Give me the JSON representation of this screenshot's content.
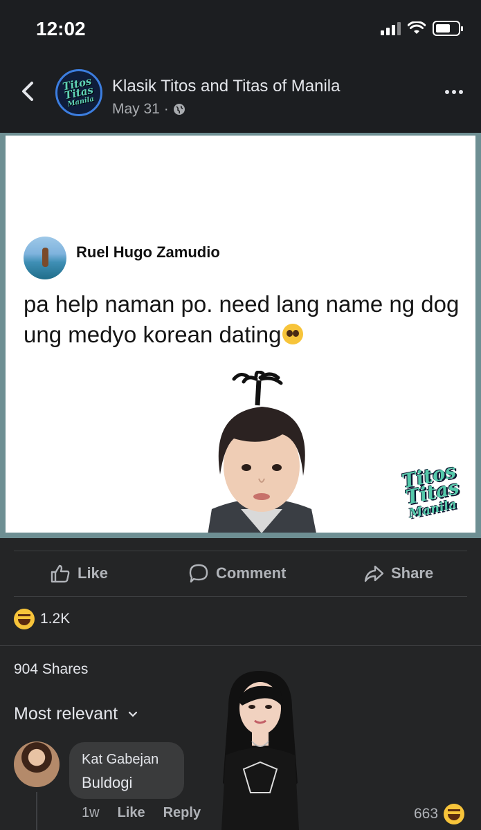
{
  "status_bar": {
    "time": "12:02"
  },
  "header": {
    "group_name": "Klasik Titos and Titas of Manila",
    "date": "May 31 ·",
    "group_logo_text": [
      "Titos",
      "Titas",
      "Manila"
    ]
  },
  "post": {
    "author": "Ruel Hugo Zamudio",
    "text": "pa help naman po. need lang name ng dog ung medyo korean dating",
    "watermark": [
      "Titos",
      "Titas",
      "Manila"
    ]
  },
  "actions": {
    "like": "Like",
    "comment": "Comment",
    "share": "Share"
  },
  "stats": {
    "reactions": "1.2K",
    "shares": "904 Shares"
  },
  "sort": {
    "label": "Most relevant"
  },
  "comment": {
    "author": "Kat Gabejan",
    "text": "Buldogi",
    "age": "1w",
    "like": "Like",
    "reply": "Reply",
    "reaction_count": "663"
  },
  "icons": [
    "signal-icon",
    "wifi-icon",
    "battery-icon",
    "back-icon",
    "globe-icon",
    "more-icon",
    "like-icon",
    "comment-icon",
    "share-icon",
    "haha-icon",
    "chevron-down-icon",
    "pleading-face-icon"
  ],
  "colors": {
    "background": "#242526",
    "header": "#1c1e21",
    "text": "#e4e6eb",
    "muted": "#b0b3b8",
    "bubble": "#3a3b3c",
    "border": "#6e8f93"
  }
}
